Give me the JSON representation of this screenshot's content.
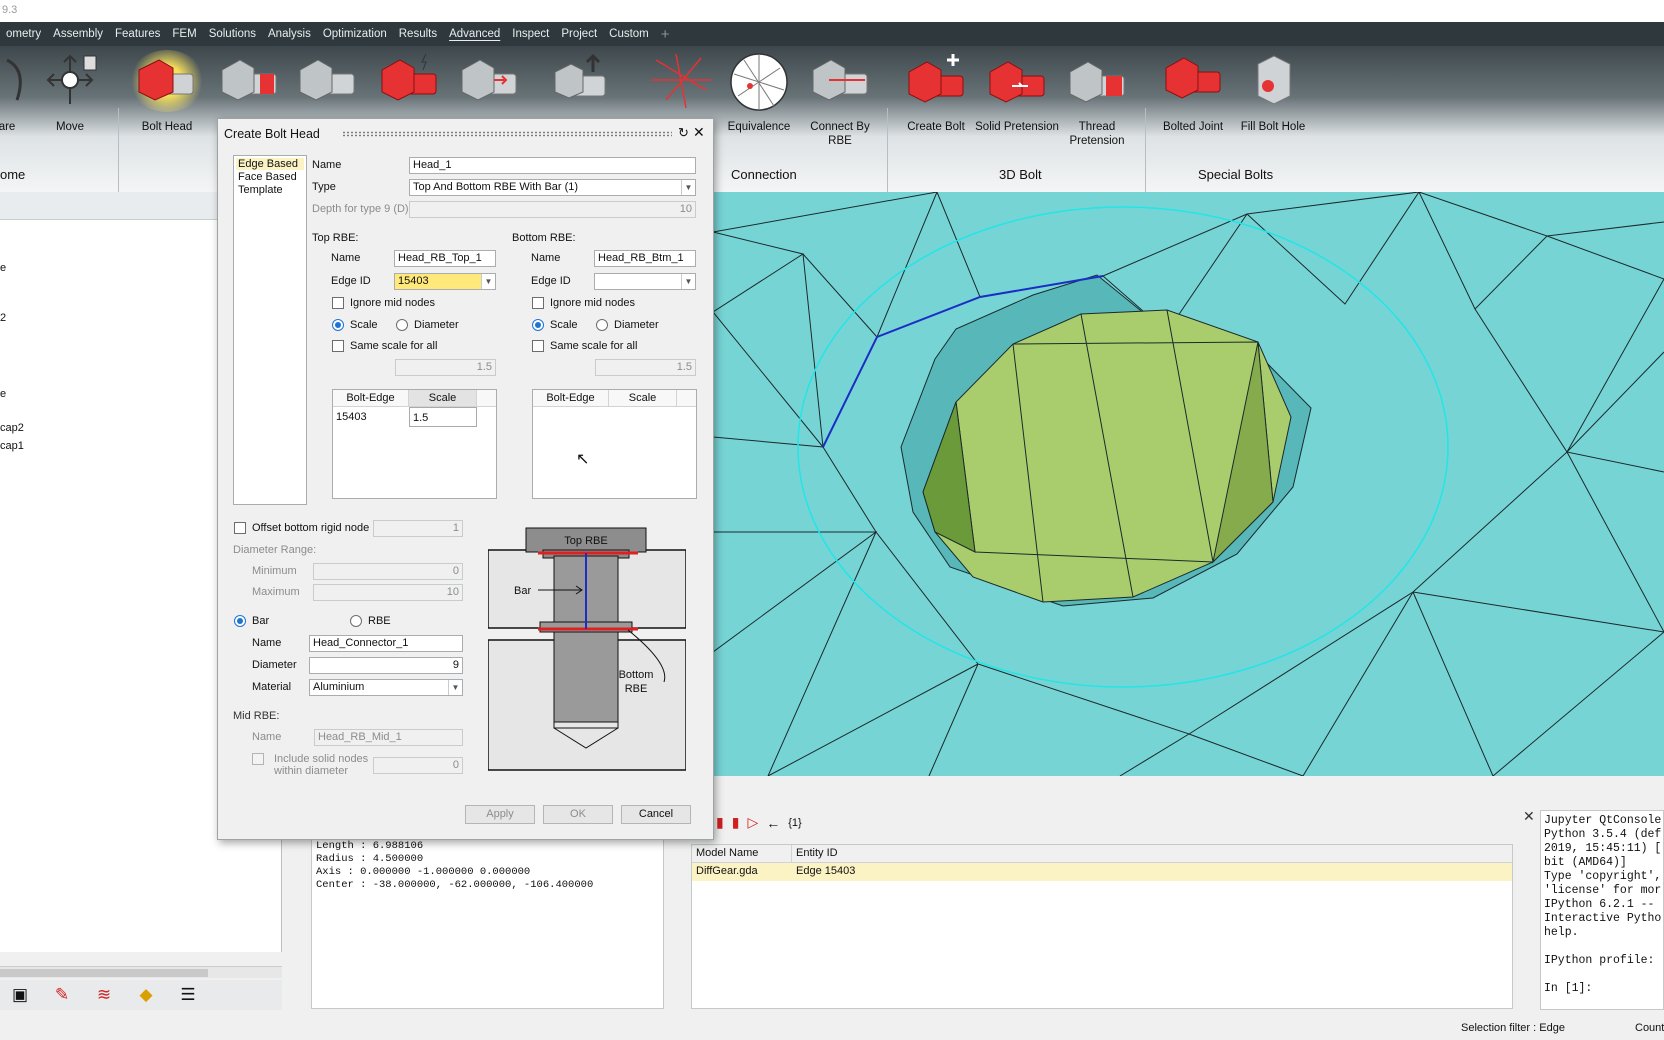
{
  "window": {
    "title_fragment": "9.3"
  },
  "menu": {
    "items": [
      "ometry",
      "Assembly",
      "Features",
      "FEM",
      "Solutions",
      "Analysis",
      "Optimization",
      "Results",
      "Advanced",
      "Inspect",
      "Project",
      "Custom"
    ],
    "active": "Advanced",
    "add": "+"
  },
  "ribbon": {
    "buttons": {
      "are": "are",
      "move": "Move",
      "bolt_head": "Bolt Head",
      "equivalence": "Equivalence",
      "connect_rbe": "Connect By RBE",
      "create_bolt": "Create Bolt",
      "solid_pretension": "Solid Pretension",
      "thread_pretension": "Thread Pretension",
      "bolted_joint": "Bolted Joint",
      "fill_bolt_hole": "Fill Bolt Hole"
    },
    "groups": {
      "home": "ome",
      "connection": "Connection",
      "bolt3d": "3D Bolt",
      "special": "Special Bolts"
    }
  },
  "tree": {
    "items": [
      "e",
      "2",
      "e",
      "cap2",
      "cap1"
    ]
  },
  "dialog": {
    "title": "Create Bolt Head",
    "modes": [
      "Edge Based",
      "Face Based",
      "Template"
    ],
    "name_label": "Name",
    "name_value": "Head_1",
    "type_label": "Type",
    "type_value": "Top And Bottom RBE With Bar (1)",
    "depth_label": "Depth for type 9 (D)",
    "depth_value": "10",
    "top": {
      "heading": "Top RBE:",
      "name_label": "Name",
      "name_value": "Head_RB_Top_1",
      "edge_label": "Edge ID",
      "edge_value": "15403",
      "ignore_mid": "Ignore mid nodes",
      "scale": "Scale",
      "diameter": "Diameter",
      "same_scale": "Same scale for all",
      "scale_value": "1.5",
      "col_edge": "Bolt-Edge",
      "col_scale": "Scale",
      "rows": [
        {
          "edge": "15403",
          "scale": "1.5"
        }
      ]
    },
    "bottom": {
      "heading": "Bottom RBE:",
      "name_label": "Name",
      "name_value": "Head_RB_Btm_1",
      "edge_label": "Edge ID",
      "edge_value": "",
      "ignore_mid": "Ignore mid nodes",
      "scale": "Scale",
      "diameter": "Diameter",
      "same_scale": "Same scale for all",
      "scale_value": "1.5",
      "col_edge": "Bolt-Edge",
      "col_scale": "Scale"
    },
    "offset_label": "Offset bottom rigid node",
    "offset_value": "1",
    "range_label": "Diameter Range:",
    "min_label": "Minimum",
    "min_value": "0",
    "max_label": "Maximum",
    "max_value": "10",
    "bar_label": "Bar",
    "rbe_label": "RBE",
    "conn_name_label": "Name",
    "conn_name_value": "Head_Connector_1",
    "conn_diam_label": "Diameter",
    "conn_diam_value": "9",
    "material_label": "Material",
    "material_value": "Aluminium",
    "mid_heading": "Mid RBE:",
    "mid_name_label": "Name",
    "mid_name_value": "Head_RB_Mid_1",
    "include_solid": "Include solid nodes",
    "within_diam": "within diameter",
    "include_value": "0",
    "diagram": {
      "top": "Top RBE",
      "bar": "Bar",
      "bottom1": "Bottom",
      "bottom2": "RBE"
    },
    "apply": "Apply",
    "ok": "OK",
    "cancel": "Cancel"
  },
  "info": {
    "lines": [
      "Length : 6.988106",
      "Radius : 4.500000",
      "Axis : 0.000000 -1.000000 0.000000",
      "Center : -38.000000, -62.000000, -106.400000"
    ]
  },
  "entity_table": {
    "count": "{1}",
    "col_model": "Model Name",
    "col_entity": "Entity ID",
    "rows": [
      {
        "model": "DiffGear.gda",
        "entity": "Edge 15403"
      }
    ]
  },
  "console": {
    "text": "Jupyter QtConsole\nPython 3.5.4 (def\n2019, 15:45:11) [\nbit (AMD64)]\nType 'copyright',\n'license' for mor\nIPython 6.2.1 --\nInteractive Pytho\nhelp.\n\nIPython profile:\n\nIn [1]:"
  },
  "status": {
    "filter": "Selection filter : Edge",
    "right": "Count"
  },
  "colors": {
    "mesh": "#77d4d5",
    "head": "#a6cc6c",
    "dialog": "#f0f0f0",
    "menubar": "#2f383c",
    "highlight_row": "#fcf3c5"
  }
}
